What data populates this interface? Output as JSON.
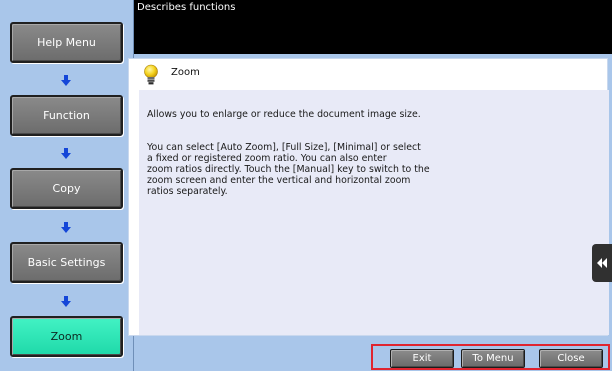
{
  "header": {
    "title": "Describes functions"
  },
  "nav": {
    "items": [
      {
        "label": "Help Menu",
        "active": false
      },
      {
        "label": "Function",
        "active": false
      },
      {
        "label": "Copy",
        "active": false
      },
      {
        "label": "Basic Settings",
        "active": false
      },
      {
        "label": "Zoom",
        "active": true
      }
    ]
  },
  "topic": {
    "icon": "lightbulb-icon",
    "title": "Zoom",
    "paragraphs": [
      "Allows you to enlarge or reduce the document image size.",
      "You can select [Auto Zoom], [Full Size], [Minimal] or select\na fixed or registered zoom ratio. You can also enter\nzoom ratios directly. Touch the  [Manual] key to switch to the\nzoom screen and enter the vertical and horizontal zoom\nratios separately."
    ]
  },
  "side_tab": {
    "icon": "double-chevron-left-icon"
  },
  "buttons": {
    "exit": "Exit",
    "to_menu": "To Menu",
    "close": "Close"
  },
  "colors": {
    "panel_blue": "#a9c6ea",
    "active_green": "#2ee6b6",
    "button_gray": "#7a7a7a",
    "highlight_red": "#e0242f"
  }
}
